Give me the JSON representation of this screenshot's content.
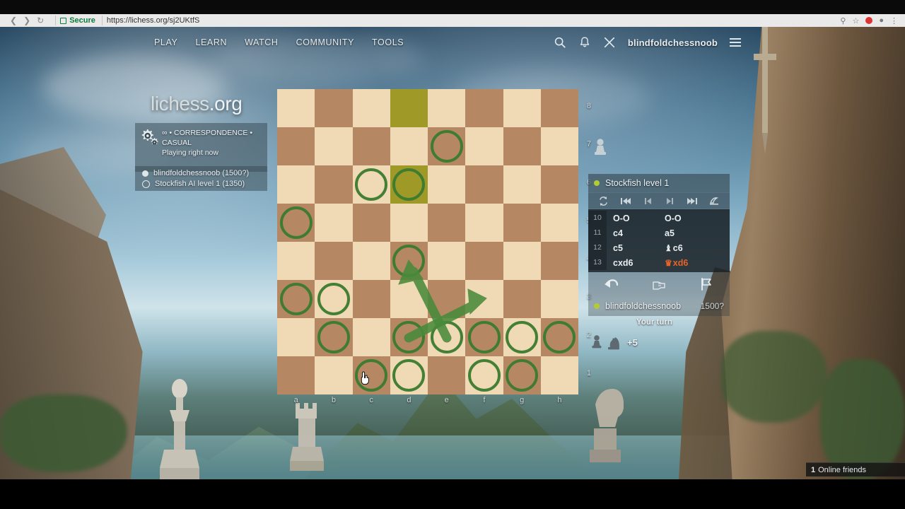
{
  "browser": {
    "back_icon": "back-arrow-icon",
    "forward_icon": "forward-arrow-icon",
    "reload_icon": "reload-icon",
    "secure_label": "Secure",
    "url": "https://lichess.org/sj2UKtfS",
    "url_visible": "https://lichess.org/",
    "url_path": "sj2UKtfS"
  },
  "header": {
    "nav": [
      {
        "label": "PLAY"
      },
      {
        "label": "LEARN"
      },
      {
        "label": "WATCH"
      },
      {
        "label": "COMMUNITY"
      },
      {
        "label": "TOOLS"
      }
    ],
    "search_icon": "search-icon",
    "bell_icon": "bell-icon",
    "challenge_icon": "crossed-swords-icon",
    "username": "blindfoldchessnoob",
    "menu_icon": "hamburger-icon"
  },
  "wordmark": {
    "name": "lichess",
    "tld": ".org"
  },
  "game_info": {
    "icon": "gears-icon",
    "line1": "∞ • CORRESPONDENCE •",
    "line2": "CASUAL",
    "line3": "Playing right now",
    "players": [
      {
        "color": "white",
        "name": "blindfoldchessnoob",
        "rating": "(1500?)",
        "text": "blindfoldchessnoob (1500?)"
      },
      {
        "color": "black",
        "name": "Stockfish AI level 1",
        "rating": "(1350)",
        "text": "Stockfish AI level 1 (1350)"
      }
    ]
  },
  "board": {
    "files": [
      "a",
      "b",
      "c",
      "d",
      "e",
      "f",
      "g",
      "h"
    ],
    "ranks": [
      "8",
      "7",
      "6",
      "5",
      "4",
      "3",
      "2",
      "1"
    ],
    "light_color": "#f0d9b5",
    "dark_color": "#b58863",
    "highlight_color": "#a5a521",
    "marker_color": "#3a7a2f",
    "orientation": "white",
    "highlighted_squares": [
      "d8",
      "d6"
    ],
    "circled_squares": [
      "e7",
      "c6",
      "d6",
      "a5",
      "d4",
      "a3",
      "b3",
      "b2",
      "d2",
      "e2",
      "f2",
      "g2",
      "h2",
      "c1",
      "d1",
      "f1",
      "g1"
    ],
    "arrows": [
      {
        "from": "e2",
        "to": "d4",
        "color": "#4a8a3c"
      },
      {
        "from": "d2",
        "to": "f3",
        "color": "#4a8a3c"
      }
    ],
    "cursor_square": "c1",
    "cursor_icon": "pointing-hand-cursor"
  },
  "game_panel": {
    "opponent": {
      "name": "Stockfish level 1",
      "status_color": "#b3cc33"
    },
    "player": {
      "name": "blindfoldchessnoob",
      "rating": "1500?",
      "status_color": "#b3cc33"
    },
    "nav_buttons": [
      {
        "name": "flip-board",
        "icon": "flip-icon"
      },
      {
        "name": "first-move",
        "icon": "skip-backward-icon"
      },
      {
        "name": "previous-move",
        "icon": "step-backward-icon"
      },
      {
        "name": "next-move",
        "icon": "step-forward-icon"
      },
      {
        "name": "last-move",
        "icon": "skip-forward-icon"
      },
      {
        "name": "menu",
        "icon": "hamburger-menu-icon"
      }
    ],
    "moves": [
      {
        "num": "10",
        "white": "O-O",
        "black": "O-O",
        "black_piece": "",
        "black_last": false
      },
      {
        "num": "11",
        "white": "c4",
        "black": "a5",
        "black_piece": "",
        "black_last": false
      },
      {
        "num": "12",
        "white": "c5",
        "black": "c6",
        "black_piece": "♝",
        "black_last": false
      },
      {
        "num": "13",
        "white": "cxd6",
        "black": "xd6",
        "black_piece": "♛",
        "black_last": true
      }
    ],
    "actions": [
      {
        "name": "takeback",
        "icon": "undo-arrow-icon"
      },
      {
        "name": "offer-draw",
        "icon": "handshake-icon"
      },
      {
        "name": "resign",
        "icon": "flag-icon"
      }
    ],
    "turn_text": "Your turn",
    "captured": {
      "pieces": [
        "♟",
        "♞"
      ],
      "advantage": "+5"
    },
    "captured_top": {
      "pieces": [
        "♙"
      ]
    }
  },
  "footer": {
    "online_count": "1",
    "online_label": "Online friends"
  }
}
